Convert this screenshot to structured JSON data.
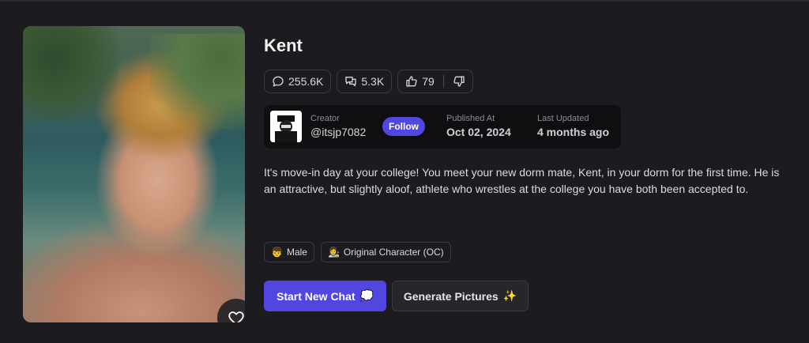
{
  "character": {
    "name": "Kent",
    "image_icon": "portrait-photo",
    "favorite_icon": "heart-icon"
  },
  "stats": {
    "chats": "255.6K",
    "messages": "5.3K",
    "likes": "79"
  },
  "creator": {
    "label": "Creator",
    "handle": "@itsjp7082",
    "follow_label": "Follow",
    "published_label": "Published At",
    "published_value": "Oct 02, 2024",
    "updated_label": "Last Updated",
    "updated_value": "4 months ago"
  },
  "description": "It's move-in day at your college! You meet your new dorm mate, Kent, in your dorm for the first time. He is an attractive, but slightly aloof, athlete who wrestles at the college you have both been accepted to.",
  "tags": [
    {
      "emoji": "👦",
      "label": "Male"
    },
    {
      "emoji": "👩‍🎨",
      "label": "Original Character (OC)"
    }
  ],
  "actions": {
    "start_chat_label": "Start New Chat",
    "start_chat_emoji": "💭",
    "generate_label": "Generate Pictures",
    "generate_emoji": "✨"
  },
  "colors": {
    "accent": "#5146e0",
    "background": "#1c1b1f",
    "card": "#0f0f11"
  }
}
